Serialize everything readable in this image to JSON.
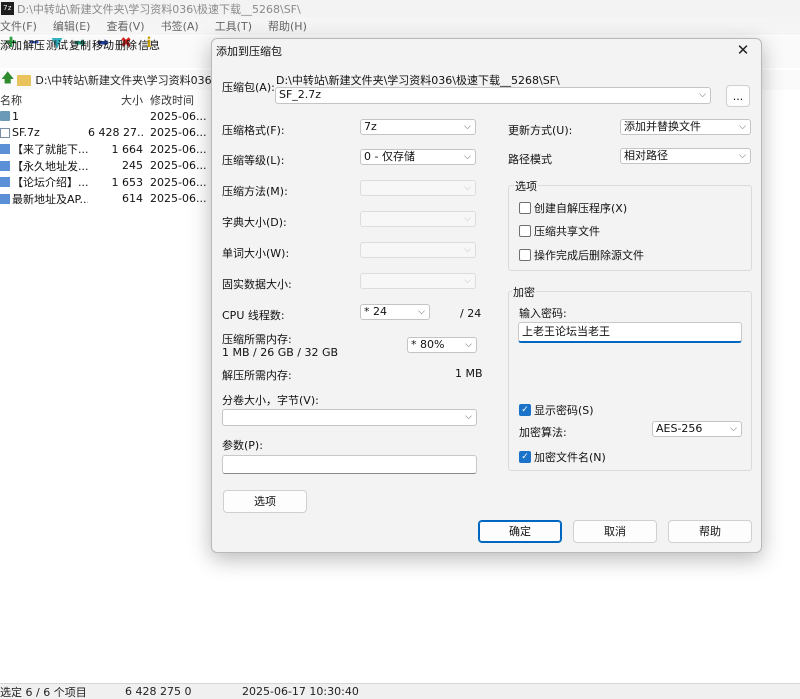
{
  "window": {
    "title": "D:\\中转站\\新建文件夹\\学习资料036\\极速下载__5268\\SF\\",
    "app_icon_text": "7z"
  },
  "menu": [
    "文件(F)",
    "编辑(E)",
    "查看(V)",
    "书签(A)",
    "工具(T)",
    "帮助(H)"
  ],
  "toolbar": [
    {
      "label": "添加",
      "icon": "plus-icon",
      "glyph": "✚",
      "color": "#2ea043"
    },
    {
      "label": "解压",
      "icon": "minus-icon",
      "glyph": "━",
      "color": "#2b4bb0"
    },
    {
      "label": "测试",
      "icon": "test-check-icon",
      "glyph": "▼",
      "color": "#35b3c4"
    },
    {
      "label": "复制",
      "icon": "copy-arrow-icon",
      "glyph": "➡",
      "color": "#1f9e83"
    },
    {
      "label": "移动",
      "icon": "move-arrow-icon",
      "glyph": "➡",
      "color": "#1f3f9e"
    },
    {
      "label": "删除",
      "icon": "delete-x-icon",
      "glyph": "✖",
      "color": "#d32020"
    },
    {
      "label": "信息",
      "icon": "info-icon",
      "glyph": "ℹ",
      "color": "#c9a000"
    }
  ],
  "address": {
    "path": "D:\\中转站\\新建文件夹\\学习资料036\\极"
  },
  "file_list": {
    "headers": {
      "name": "名称",
      "size": "大小",
      "modified": "修改时间"
    },
    "rows": [
      {
        "icon": "folder",
        "name": "1",
        "size": "",
        "modified": "2025-06..."
      },
      {
        "icon": "file",
        "name": "SF.7z",
        "size": "6 428 27...",
        "modified": "2025-06..."
      },
      {
        "icon": "doc",
        "name": "【来了就能下...",
        "size": "1 664",
        "modified": "2025-06..."
      },
      {
        "icon": "doc",
        "name": "【永久地址发...",
        "size": "245",
        "modified": "2025-06..."
      },
      {
        "icon": "doc",
        "name": "【论坛介绍】...",
        "size": "1 653",
        "modified": "2025-06..."
      },
      {
        "icon": "doc",
        "name": "最新地址及AP...",
        "size": "614",
        "modified": "2025-06..."
      }
    ]
  },
  "status": {
    "selection": "选定 6 / 6 个项目",
    "size": "6 428 275 0",
    "time": "2025-06-17 10:30:40"
  },
  "dialog": {
    "title": "添加到压缩包",
    "close_glyph": "✕",
    "archive_label": "压缩包(A):",
    "archive_dir": "D:\\中转站\\新建文件夹\\学习资料036\\极速下载__5268\\SF\\",
    "archive_name": "SF_2.7z",
    "browse_label": "...",
    "format_label": "压缩格式(F):",
    "format_value": "7z",
    "level_label": "压缩等级(L):",
    "level_value": "0 - 仅存储",
    "method_label": "压缩方法(M):",
    "dict_label": "字典大小(D):",
    "word_label": "单词大小(W):",
    "solid_label": "固实数据大小:",
    "threads_label": "CPU 线程数:",
    "threads_value": "* 24",
    "threads_max": "/ 24",
    "mem_comp_label": "压缩所需内存:",
    "mem_comp_detail": "1 MB / 26 GB / 32 GB",
    "mem_comp_value": "* 80%",
    "mem_decomp_label": "解压所需内存:",
    "mem_decomp_value": "1 MB",
    "volume_label": "分卷大小，字节(V):",
    "params_label": "参数(P):",
    "options_button": "选项",
    "update_label": "更新方式(U):",
    "update_value": "添加并替换文件",
    "path_mode_label": "路径模式",
    "path_mode_value": "相对路径",
    "options_group": "选项",
    "opt_sfx": "创建自解压程序(X)",
    "opt_shared": "压缩共享文件",
    "opt_delete": "操作完成后删除源文件",
    "encryption_group": "加密",
    "password_label": "输入密码:",
    "password_value": "上老王论坛当老王",
    "show_password": "显示密码(S)",
    "enc_method_label": "加密算法:",
    "enc_method_value": "AES-256",
    "encrypt_names": "加密文件名(N)",
    "ok": "确定",
    "cancel": "取消",
    "help": "帮助"
  }
}
